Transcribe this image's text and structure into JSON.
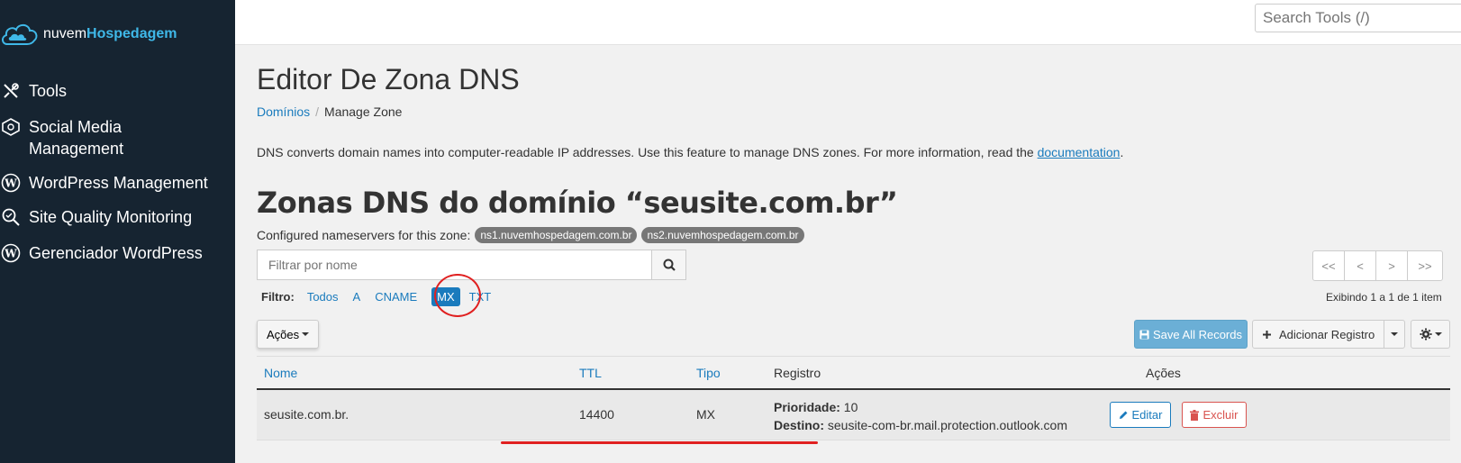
{
  "sidebar": {
    "logo": {
      "prefix": "nuvem",
      "brand": "Hospedagem"
    },
    "items": [
      {
        "label": "Tools",
        "icon": "tools-icon"
      },
      {
        "label": "Social Media",
        "label2": "Management",
        "icon": "social-media-icon"
      },
      {
        "label": "WordPress Management",
        "icon": "wordpress-icon"
      },
      {
        "label": "Site Quality Monitoring",
        "icon": "magnifier-icon"
      },
      {
        "label": "Gerenciador WordPress",
        "icon": "wordpress-icon"
      }
    ]
  },
  "topbar": {
    "search_placeholder": "Search Tools (/)"
  },
  "page": {
    "title": "Editor De Zona DNS",
    "breadcrumb": {
      "link": "Domínios",
      "current": "Manage Zone"
    },
    "description": "DNS converts domain names into computer-readable IP addresses. Use this feature to manage DNS zones. For more information, read the ",
    "description_link": "documentation",
    "description_end": ".",
    "zone_title": "Zonas DNS do domínio “seusite.com.br”",
    "ns_label": "Configured nameservers for this zone:",
    "nameservers": [
      "ns1.nuvemhospedagem.com.br",
      "ns2.nuvemhospedagem.com.br"
    ],
    "filter_placeholder": "Filtrar por nome",
    "filter_label": "Filtro:",
    "filters": [
      "Todos",
      "A",
      "CNAME",
      "MX",
      "TXT"
    ],
    "active_filter": "MX",
    "pager": [
      "<<",
      "<",
      ">",
      ">>"
    ],
    "showing": "Exibindo 1 a 1 de 1 item",
    "actions_label": "Ações",
    "save_label": "Save All Records",
    "add_label": "Adicionar Registro"
  },
  "table": {
    "headers": {
      "nome": "Nome",
      "ttl": "TTL",
      "tipo": "Tipo",
      "registro": "Registro",
      "acoes": "Ações"
    },
    "rows": [
      {
        "nome": "seusite.com.br.",
        "ttl": "14400",
        "tipo": "MX",
        "prioridade_label": "Prioridade:",
        "prioridade": "10",
        "destino_label": "Destino:",
        "destino": "seusite-com-br.mail.protection.outlook.com",
        "edit_label": "Editar",
        "delete_label": "Excluir"
      }
    ]
  },
  "colors": {
    "sidebar": "#162431",
    "accent": "#1a7bbd",
    "danger": "#d9534f",
    "highlight": "#e02020"
  }
}
